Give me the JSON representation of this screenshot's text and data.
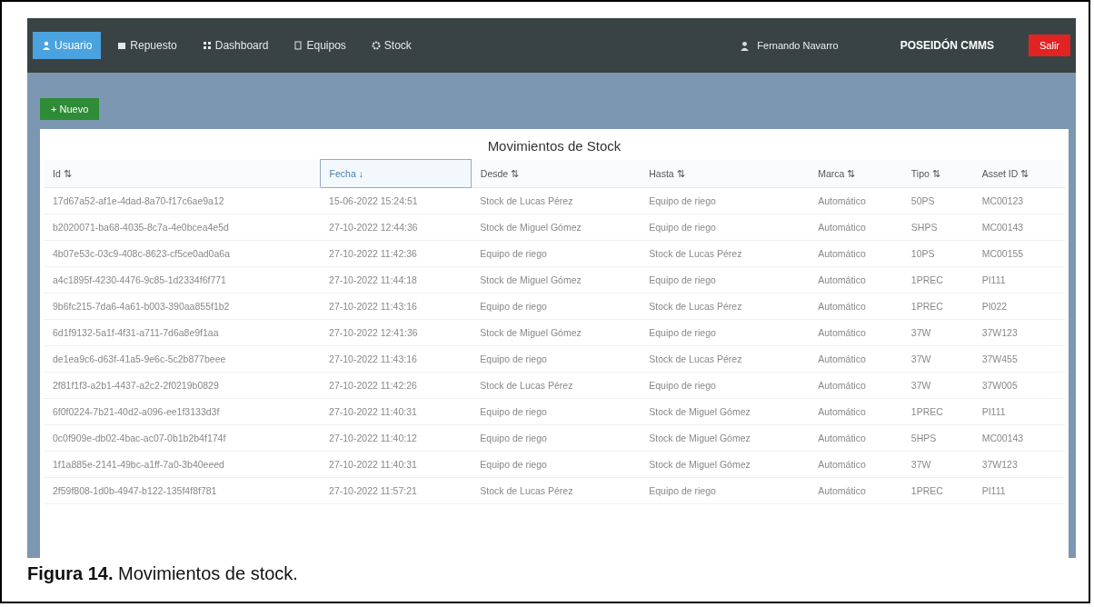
{
  "navbar": {
    "items": [
      {
        "label": "Usuario",
        "selected": true
      },
      {
        "label": "Repuesto",
        "selected": false
      },
      {
        "label": "Dashboard",
        "selected": false
      },
      {
        "label": "Equipos",
        "selected": false
      },
      {
        "label": "Stock",
        "selected": false
      }
    ],
    "user": "Fernando Navarro",
    "brand": "POSEIDÓN CMMS",
    "logout": "Salir"
  },
  "new_button": "+ Nuevo",
  "table": {
    "title": "Movimientos de Stock",
    "columns": [
      {
        "label": "Id",
        "sort": "⇅",
        "selected": false
      },
      {
        "label": "Fecha",
        "sort": "↓",
        "selected": true
      },
      {
        "label": "Desde",
        "sort": "⇅",
        "selected": false
      },
      {
        "label": "Hasta",
        "sort": "⇅",
        "selected": false
      },
      {
        "label": "Marca",
        "sort": "⇅",
        "selected": false
      },
      {
        "label": "Tipo",
        "sort": "⇅",
        "selected": false
      },
      {
        "label": "Asset ID",
        "sort": "⇅",
        "selected": false
      }
    ],
    "rows": [
      [
        "17d67a52-af1e-4dad-8a70-f17c6ae9a12",
        "15-06-2022 15:24:51",
        "Stock de Lucas Pérez",
        "Equipo de riego",
        "Automático",
        "50PS",
        "MC00123"
      ],
      [
        "b2020071-ba68-4035-8c7a-4e0bcea4e5d",
        "27-10-2022 12:44:36",
        "Stock de Miguel Gómez",
        "Equipo de riego",
        "Automático",
        "SHPS",
        "MC00143"
      ],
      [
        "4b07e53c-03c9-408c-8623-cf5ce0ad0a6a",
        "27-10-2022 11:42:36",
        "Equipo de riego",
        "Stock de Lucas Pérez",
        "Automático",
        "10PS",
        "MC00155"
      ],
      [
        "a4c1895f-4230-4476-9c85-1d2334f6f771",
        "27-10-2022 11:44:18",
        "Stock de Miguel Gómez",
        "Equipo de riego",
        "Automático",
        "1PREC",
        "PI111"
      ],
      [
        "9b6fc215-7da6-4a61-b003-390aa855f1b2",
        "27-10-2022 11:43:16",
        "Equipo de riego",
        "Stock de Lucas Pérez",
        "Automático",
        "1PREC",
        "PI022"
      ],
      [
        "6d1f9132-5a1f-4f31-a711-7d6a8e9f1aa",
        "27-10-2022 12:41:36",
        "Stock de Miguel Gómez",
        "Equipo de riego",
        "Automático",
        "37W",
        "37W123"
      ],
      [
        "de1ea9c6-d63f-41a5-9e6c-5c2b877beee",
        "27-10-2022 11:43:16",
        "Equipo de riego",
        "Stock de Lucas Pérez",
        "Automático",
        "37W",
        "37W455"
      ],
      [
        "2f81f1f3-a2b1-4437-a2c2-2f0219b0829",
        "27-10-2022 11:42:26",
        "Stock de Lucas Pérez",
        "Equipo de riego",
        "Automático",
        "37W",
        "37W005"
      ],
      [
        "6f0f0224-7b21-40d2-a096-ee1f3133d3f",
        "27-10-2022 11:40:31",
        "Equipo de riego",
        "Stock de Miguel Gómez",
        "Automático",
        "1PREC",
        "PI111"
      ],
      [
        "0c0f909e-db02-4bac-ac07-0b1b2b4f174f",
        "27-10-2022 11:40:12",
        "Equipo de riego",
        "Stock de Miguel Gómez",
        "Automático",
        "5HPS",
        "MC00143"
      ],
      [
        "1f1a885e-2141-49bc-a1ff-7a0-3b40eeed",
        "27-10-2022 11:40:31",
        "Equipo de riego",
        "Stock de Miguel Gómez",
        "Automático",
        "37W",
        "37W123"
      ],
      [
        "2f59f808-1d0b-4947-b122-135f4f8f781",
        "27-10-2022 11:57:21",
        "Stock de Lucas Pérez",
        "Equipo de riego",
        "Automático",
        "1PREC",
        "PI111"
      ]
    ]
  },
  "caption": {
    "label": "Figura 14.",
    "text": "Movimientos de stock."
  }
}
